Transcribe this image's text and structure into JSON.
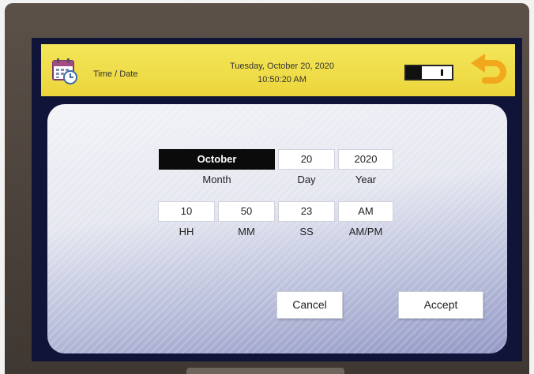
{
  "header": {
    "title": "Time / Date",
    "date_line": "Tuesday, October 20, 2020",
    "time_line": "10:50:20 AM",
    "battery_level": 0.5
  },
  "icons": {
    "calendar": "calendar-clock-icon",
    "back": "undo-arrow-icon"
  },
  "date_fields": {
    "month": {
      "value": "October",
      "label": "Month"
    },
    "day": {
      "value": "20",
      "label": "Day"
    },
    "year": {
      "value": "2020",
      "label": "Year"
    }
  },
  "time_fields": {
    "hh": {
      "value": "10",
      "label": "HH"
    },
    "mm": {
      "value": "50",
      "label": "MM"
    },
    "ss": {
      "value": "23",
      "label": "SS"
    },
    "ampm": {
      "value": "AM",
      "label": "AM/PM"
    }
  },
  "buttons": {
    "cancel": "Cancel",
    "accept": "Accept"
  },
  "colors": {
    "header": "#ecd53b",
    "accent_back": "#f2a81d",
    "selected_field": "#0b0b0b"
  }
}
